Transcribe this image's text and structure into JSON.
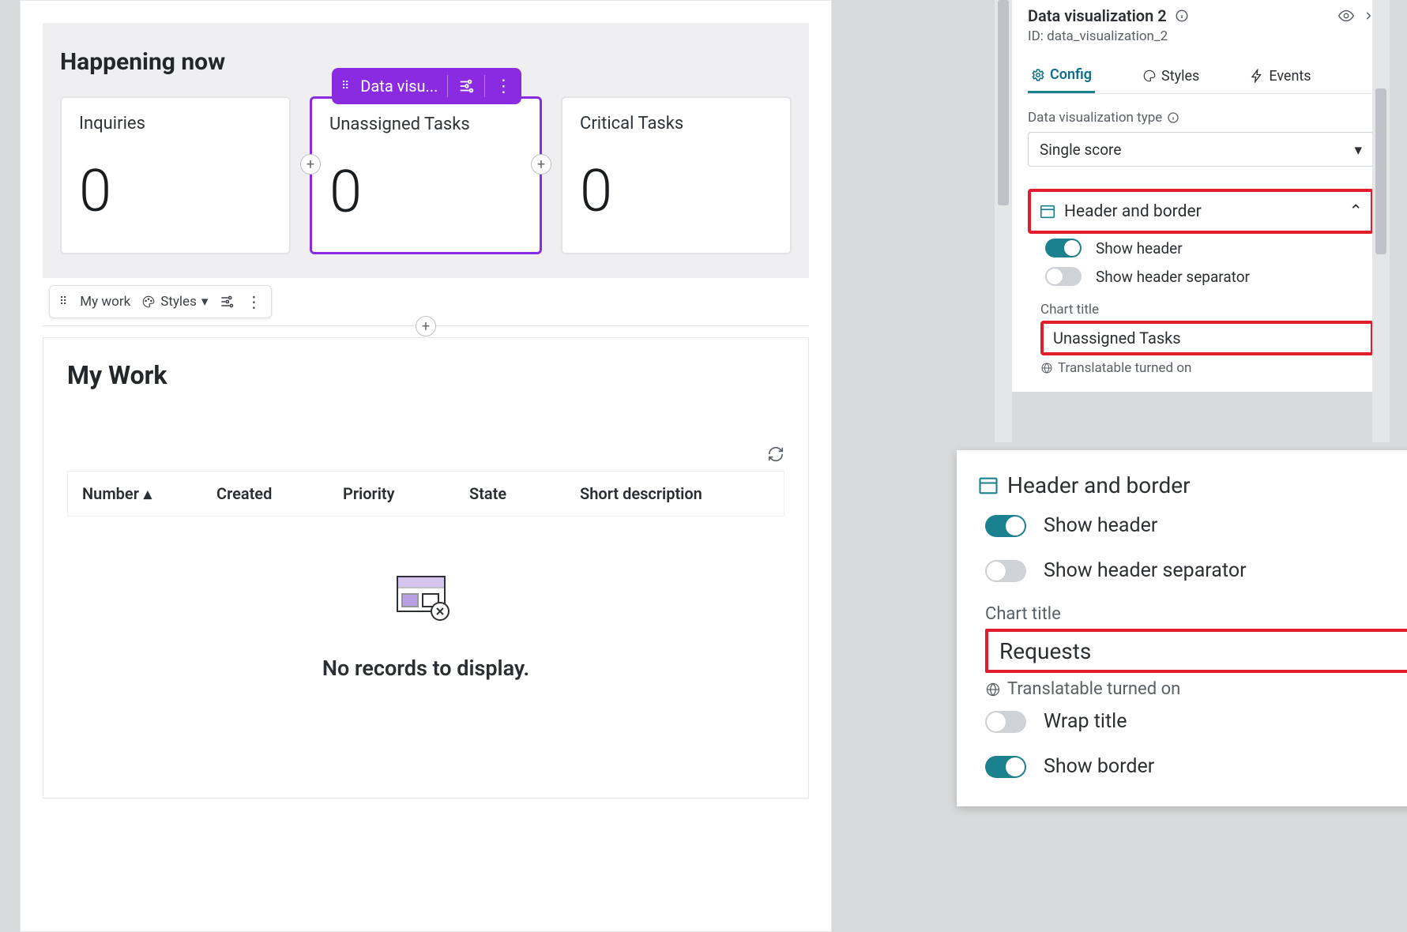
{
  "canvas": {
    "happening_title": "Happening now",
    "cards": [
      {
        "title": "Inquiries",
        "value": "0"
      },
      {
        "title": "Unassigned Tasks",
        "value": "0"
      },
      {
        "title": "Critical Tasks",
        "value": "0"
      }
    ],
    "floating_pill_label": "Data visu...",
    "floating_toolbar": {
      "name": "My work",
      "styles": "Styles"
    },
    "mywork": {
      "title": "My Work",
      "columns": [
        "Number",
        "Created",
        "Priority",
        "State",
        "Short description"
      ],
      "empty_text": "No records to display."
    }
  },
  "panel1": {
    "name": "Data visualization 2",
    "id_label": "ID:",
    "id_value": "data_visualization_2",
    "tabs": {
      "config": "Config",
      "styles": "Styles",
      "events": "Events"
    },
    "type_label": "Data visualization type",
    "type_value": "Single score",
    "header_border_label": "Header and border",
    "show_header": "Show header",
    "show_sep": "Show header separator",
    "chart_title_label": "Chart title",
    "chart_title_value": "Unassigned Tasks",
    "translatable": "Translatable turned on"
  },
  "panel2": {
    "header_border_label": "Header and border",
    "show_header": "Show header",
    "show_sep": "Show header separator",
    "chart_title_label": "Chart title",
    "chart_title_value": "Requests",
    "translatable": "Translatable turned on",
    "wrap_title": "Wrap title",
    "show_border": "Show border"
  }
}
